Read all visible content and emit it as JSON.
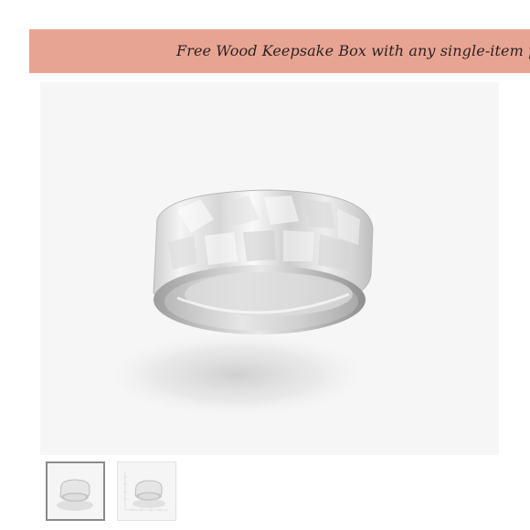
{
  "promo": {
    "text": "Free Wood Keepsake Box with any single-item purchase"
  },
  "product_image": {
    "description_icon": "hammered-ring-image",
    "background": "#f6f6f6"
  },
  "favorite": {
    "icon": "heart-outline-icon",
    "color": "#e0605a"
  },
  "thumbnails": [
    {
      "icon": "ring-thumbnail",
      "selected": true
    },
    {
      "icon": "ring-with-ruler-thumbnail",
      "selected": false
    }
  ]
}
